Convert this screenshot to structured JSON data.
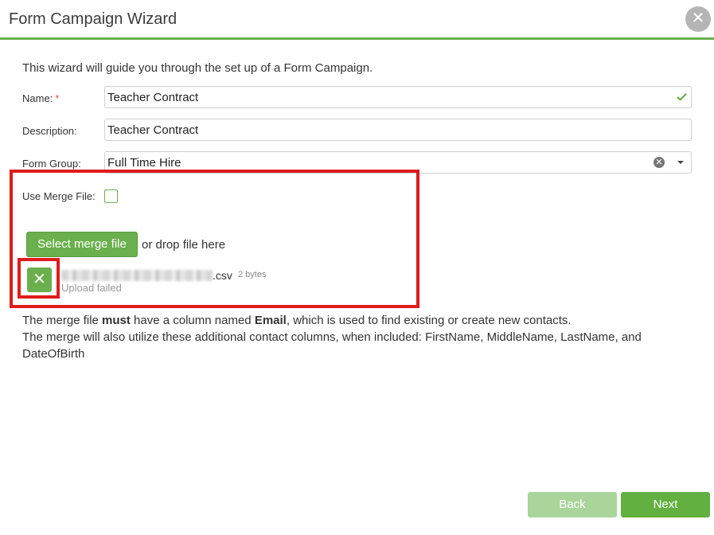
{
  "dialog": {
    "title": "Form Campaign Wizard"
  },
  "intro": "This wizard will guide you through the set up of a Form Campaign.",
  "form": {
    "name_label": "Name:",
    "required_mark": "*",
    "name_value": "Teacher Contract",
    "description_label": "Description:",
    "description_value": "Teacher Contract",
    "form_group_label": "Form Group:",
    "form_group_value": "Full Time Hire",
    "merge_label": "Use Merge File:",
    "merge_checked": false
  },
  "upload": {
    "select_button": "Select merge file",
    "drop_text": "or drop file here",
    "file_ext": ".csv",
    "file_size": "2 bytes",
    "status": "Upload failed"
  },
  "note": {
    "part1": "The merge file ",
    "must": "must",
    "part2": " have a column named ",
    "email": "Email",
    "part3": ", which is used to find existing or create new contacts.",
    "line2": "The merge will also utilize these additional contact columns, when included: FirstName, MiddleName, LastName, and DateOfBirth"
  },
  "footer": {
    "back": "Back",
    "next": "Next"
  },
  "colors": {
    "accent": "#6ab04c",
    "highlight": "#e01b1b"
  },
  "icons": {
    "close": "close-icon",
    "valid": "check-icon",
    "clear": "clear-icon",
    "dropdown": "chevron-down-icon",
    "remove": "x-icon"
  }
}
